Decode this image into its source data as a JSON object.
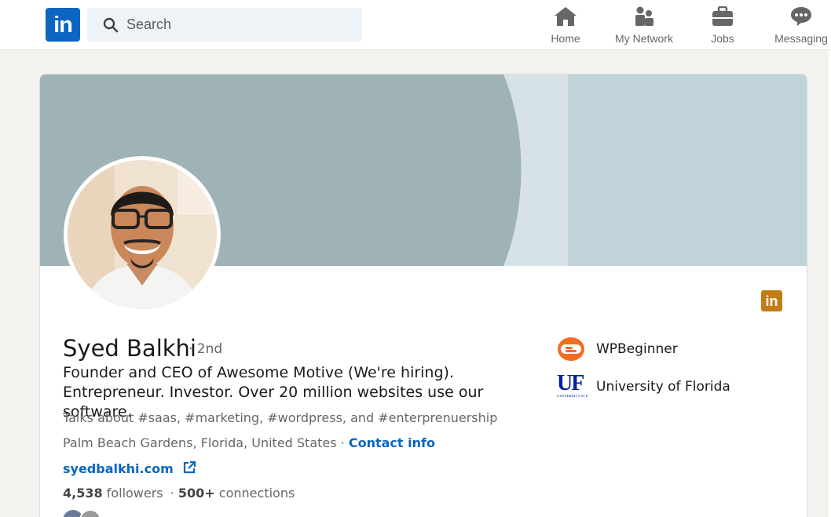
{
  "nav": {
    "logo_text": "in",
    "search_placeholder": "Search",
    "items": [
      {
        "label": "Home",
        "icon": "home-icon"
      },
      {
        "label": "My Network",
        "icon": "network-icon"
      },
      {
        "label": "Jobs",
        "icon": "briefcase-icon"
      },
      {
        "label": "Messaging",
        "icon": "chat-icon"
      }
    ]
  },
  "profile": {
    "name": "Syed Balkhi",
    "degree": "· 2nd",
    "headline": "Founder and CEO of Awesome Motive (We're hiring). Entrepreneur. Investor. Over 20 million websites use our software.",
    "talks_about": "Talks about #saas, #marketing, #wordpress, and #enterprenuership",
    "location": "Palm Beach Gardens, Florida, United States",
    "location_sep": " · ",
    "contact_label": "Contact info",
    "website": "syedbalkhi.com",
    "followers_count": "4,538",
    "followers_label": " followers",
    "connections_sep": " · ",
    "connections_count": "500+",
    "connections_label": " connections",
    "badge_text": "in",
    "organizations": [
      {
        "name": "WPBeginner",
        "logo": "wpbeginner-logo"
      },
      {
        "name": "University of Florida",
        "logo": "uf-logo",
        "logo_text": "UF",
        "logo_subtext": "UNIVERSITY of FLORIDA"
      }
    ]
  },
  "colors": {
    "brand": "#0a66c2",
    "banner_dark": "#9fb2b6",
    "banner_light": "#bfd3d8",
    "badge": "#c37d16",
    "wpbeginner_orange": "#f26c21",
    "uf_blue": "#0021a5"
  }
}
